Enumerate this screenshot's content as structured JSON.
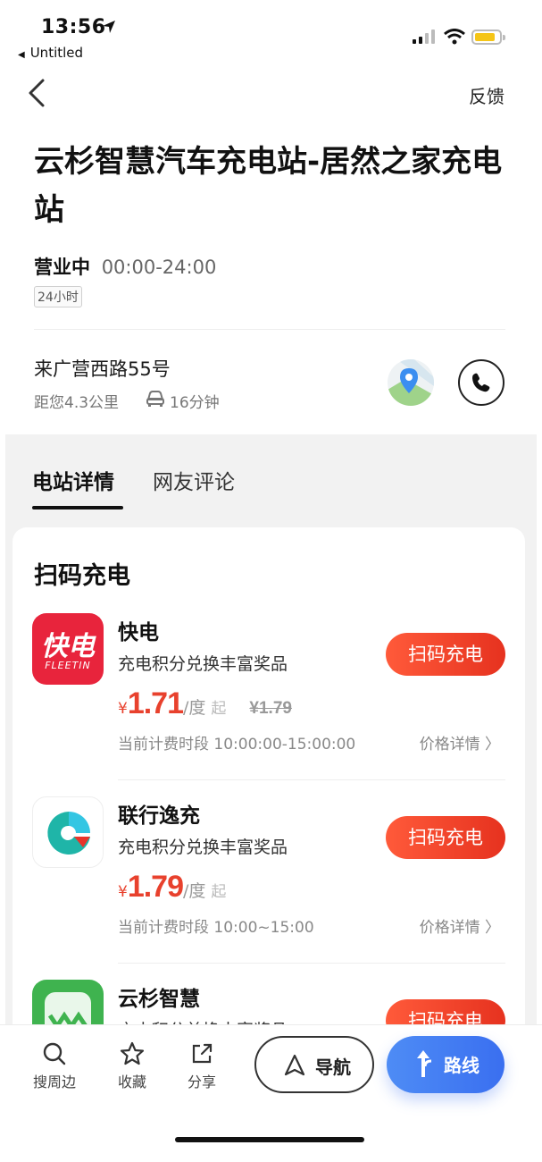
{
  "status_bar": {
    "time": "13:56",
    "back_app": "Untitled",
    "battery_color": "#f5c518"
  },
  "nav": {
    "feedback": "反馈"
  },
  "station": {
    "title": "云杉智慧汽车充电站-居然之家充电站",
    "status": "营业中",
    "hours": "00:00-24:00",
    "tag": "24小时",
    "address": "来广营西路55号",
    "distance": "距您4.3公里",
    "drive_time": "16分钟"
  },
  "tabs": [
    {
      "label": "电站详情",
      "active": true
    },
    {
      "label": "网友评论",
      "active": false
    }
  ],
  "scan_section": {
    "title": "扫码充电",
    "operators": [
      {
        "name": "快电",
        "logo_text": "快电",
        "logo_subtext": "FLEETIN",
        "subtitle": "充电积分兑换丰富奖品",
        "currency": "¥",
        "price": "1.71",
        "unit": "/度",
        "suffix": "起",
        "original_price": "¥1.79",
        "period": "当前计费时段 10:00:00-15:00:00",
        "price_detail": "价格详情",
        "button": "扫码充电"
      },
      {
        "name": "联行逸充",
        "subtitle": "充电积分兑换丰富奖品",
        "currency": "¥",
        "price": "1.79",
        "unit": "/度",
        "suffix": "起",
        "period": "当前计费时段 10:00~15:00",
        "price_detail": "价格详情",
        "button": "扫码充电"
      },
      {
        "name": "云杉智慧",
        "subtitle": "充电积分兑换丰富奖品",
        "button": "扫码充电"
      }
    ]
  },
  "bottom_bar": {
    "search_nearby": "搜周边",
    "favorite": "收藏",
    "share": "分享",
    "navigate": "导航",
    "route": "路线"
  },
  "colors": {
    "accent_red": "#e8412d",
    "route_blue": "#3a6ff0",
    "fleetin_red": "#e8243c"
  }
}
